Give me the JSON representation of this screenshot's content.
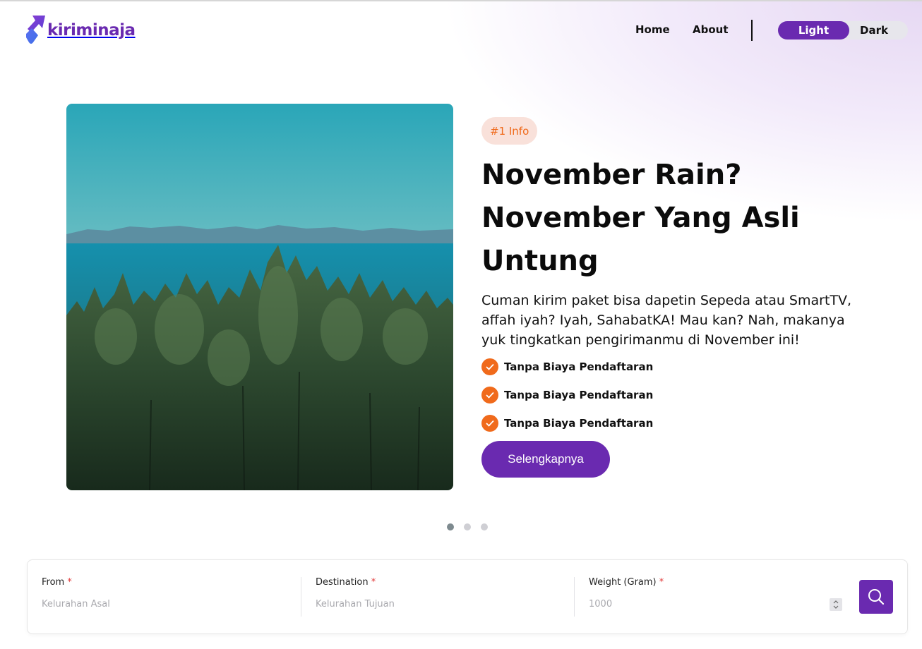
{
  "brand": {
    "name": "kiriminaja",
    "accent": "#6a2ab0",
    "orange": "#f06a1b"
  },
  "nav": {
    "home": "Home",
    "about": "About"
  },
  "theme": {
    "light": "Light",
    "dark": "Dark",
    "selected": "Light"
  },
  "hero": {
    "badge": "#1 Info",
    "headline_line1": "November Rain?",
    "headline_line2": "November Yang Asli",
    "headline_line3": "Untung",
    "description": "Cuman kirim paket bisa dapetin Sepeda atau SmartTV, affah iyah? Iyah, SahabatKA! Mau kan? Nah, makanya yuk tingkatkan pengirimanmu di November ini!",
    "checks": [
      "Tanpa Biaya Pendaftaran",
      "Tanpa Biaya Pendaftaran",
      "Tanpa Biaya Pendaftaran"
    ],
    "cta": "Selengkapnya",
    "carousel": {
      "total": 3,
      "active": 1
    }
  },
  "search": {
    "from": {
      "label": "From",
      "required": "*",
      "placeholder": "Kelurahan Asal",
      "value": ""
    },
    "destination": {
      "label": "Destination",
      "required": "*",
      "placeholder": "Kelurahan Tujuan",
      "value": ""
    },
    "weight": {
      "label": "Weight (Gram)",
      "required": "*",
      "placeholder": "1000",
      "value": ""
    },
    "button_icon": "search-icon"
  }
}
